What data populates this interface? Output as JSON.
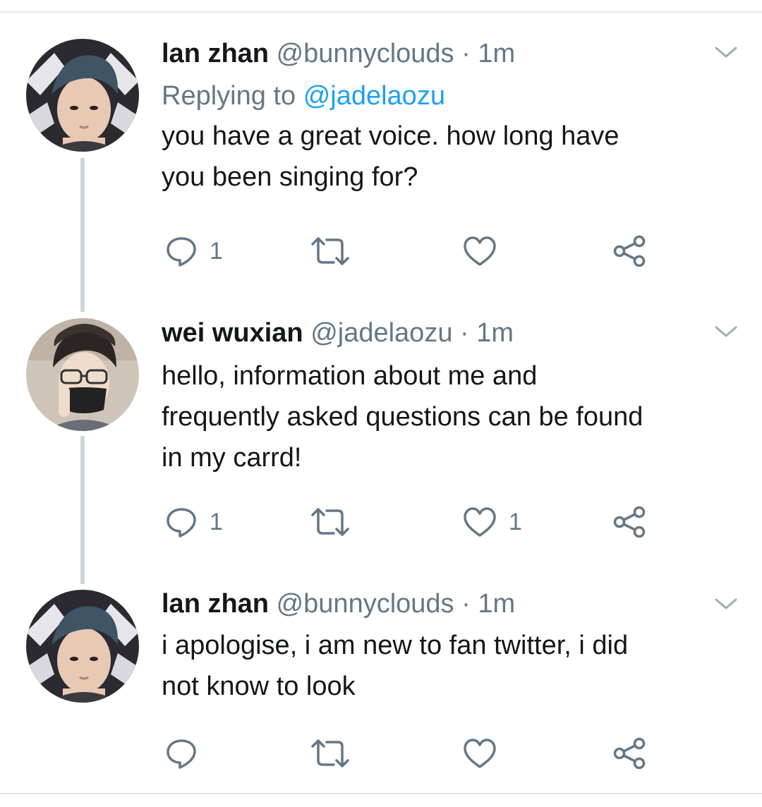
{
  "colors": {
    "text": "#14171a",
    "secondary": "#657786",
    "link": "#1da1f2",
    "divider": "#e1e8ed",
    "thread_line": "#ccd6dd"
  },
  "tweets": [
    {
      "name": "lan zhan",
      "handle": "@bunnyclouds",
      "separator": "·",
      "time": "1m",
      "replying_prefix": "Replying to",
      "replying_to": "@jadelaozu",
      "lines": [
        "you have a great voice. how long have",
        "you been singing for?"
      ],
      "reply_count": "1",
      "retweet_count": "",
      "like_count": "",
      "avatar_icon": "avatar-photo-icon"
    },
    {
      "name": "wei wuxian",
      "handle": "@jadelaozu",
      "separator": "·",
      "time": "1m",
      "lines": [
        "hello, information about me and",
        "frequently asked questions can be found",
        "in my carrd!"
      ],
      "reply_count": "1",
      "retweet_count": "",
      "like_count": "1",
      "avatar_icon": "avatar-photo-icon"
    },
    {
      "name": "lan zhan",
      "handle": "@bunnyclouds",
      "separator": "·",
      "time": "1m",
      "lines": [
        "i apologise, i am new to fan twitter, i did",
        "not know to look"
      ],
      "reply_count": "",
      "retweet_count": "",
      "like_count": "",
      "avatar_icon": "avatar-photo-icon"
    }
  ]
}
